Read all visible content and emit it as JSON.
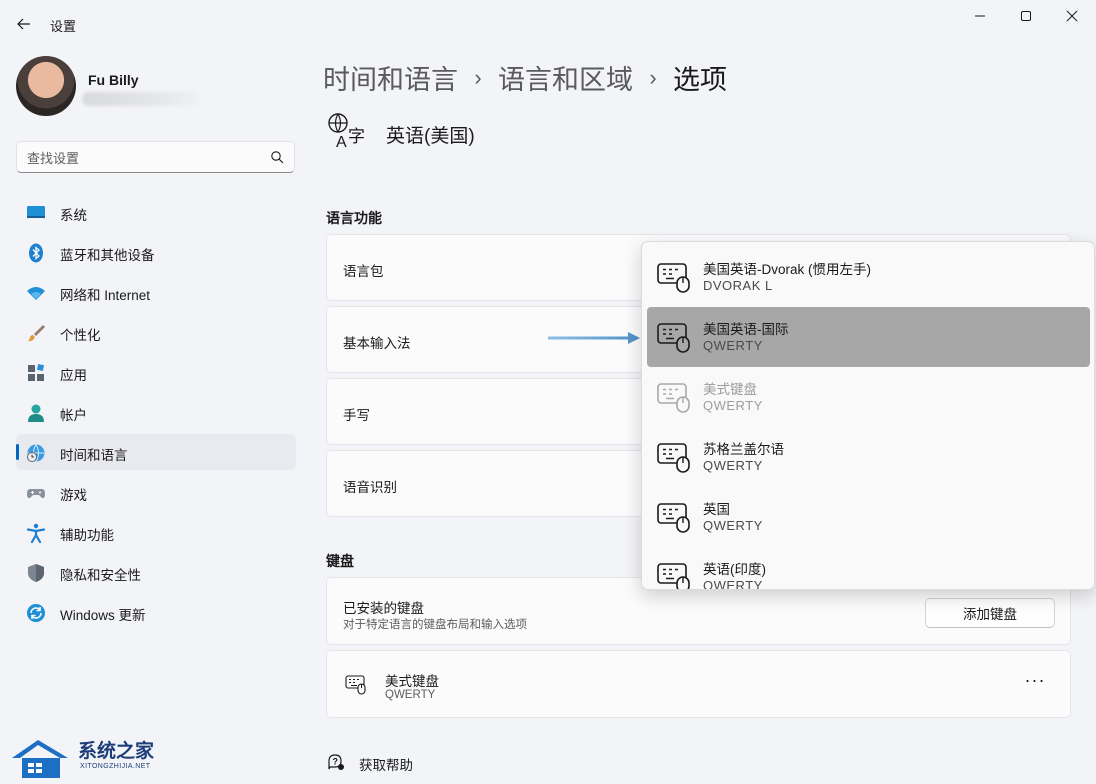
{
  "window": {
    "title": "设置",
    "icons": {
      "back": "back-arrow-icon",
      "minimize": "minimize-icon",
      "maximize": "maximize-icon",
      "close": "close-icon"
    }
  },
  "user": {
    "name": "Fu Billy"
  },
  "search": {
    "placeholder": "查找设置"
  },
  "sidebar": {
    "items": [
      {
        "label": "系统",
        "icon": "system-icon"
      },
      {
        "label": "蓝牙和其他设备",
        "icon": "bluetooth-icon"
      },
      {
        "label": "网络和 Internet",
        "icon": "wifi-icon"
      },
      {
        "label": "个性化",
        "icon": "brush-icon"
      },
      {
        "label": "应用",
        "icon": "apps-icon"
      },
      {
        "label": "帐户",
        "icon": "account-icon"
      },
      {
        "label": "时间和语言",
        "icon": "time-language-icon",
        "active": true
      },
      {
        "label": "游戏",
        "icon": "gamepad-icon"
      },
      {
        "label": "辅助功能",
        "icon": "accessibility-icon"
      },
      {
        "label": "隐私和安全性",
        "icon": "shield-icon"
      },
      {
        "label": "Windows 更新",
        "icon": "update-icon"
      }
    ]
  },
  "breadcrumb": {
    "level1": "时间和语言",
    "level2": "语言和区域",
    "current": "选项",
    "separator": "›"
  },
  "language": {
    "title": "英语(美国)",
    "icon": "language-icon"
  },
  "language_features": {
    "section_title": "语言功能",
    "rows": [
      {
        "label": "语言包"
      },
      {
        "label": "基本输入法"
      },
      {
        "label": "手写"
      },
      {
        "label": "语音识别"
      }
    ]
  },
  "keyboard": {
    "section_title": "键盘",
    "installed_label": "已安装的键盘",
    "installed_desc": "对于特定语言的键盘布局和输入选项",
    "add_button": "添加键盘",
    "current": {
      "name": "美式键盘",
      "layout": "QWERTY",
      "more": "···"
    }
  },
  "dropdown": {
    "items": [
      {
        "name": "美国英语-Dvorak (惯用左手)",
        "layout": "DVORAK L",
        "state": "normal"
      },
      {
        "name": "美国英语-国际",
        "layout": "QWERTY",
        "state": "selected"
      },
      {
        "name": "美式键盘",
        "layout": "QWERTY",
        "state": "disabled"
      },
      {
        "name": "苏格兰盖尔语",
        "layout": "QWERTY",
        "state": "normal"
      },
      {
        "name": "英国",
        "layout": "QWERTY",
        "state": "normal"
      },
      {
        "name": "英语(印度)",
        "layout": "QWERTY",
        "state": "normal"
      }
    ]
  },
  "help": {
    "label": "获取帮助",
    "icon": "help-icon"
  },
  "watermark": {
    "title": "系统之家",
    "subtitle": "XITONGZHIJIA.NET"
  },
  "colors": {
    "accent": "#0067c0",
    "arrow": "#5b9bd5",
    "selected_item": "#a7a7a7"
  }
}
